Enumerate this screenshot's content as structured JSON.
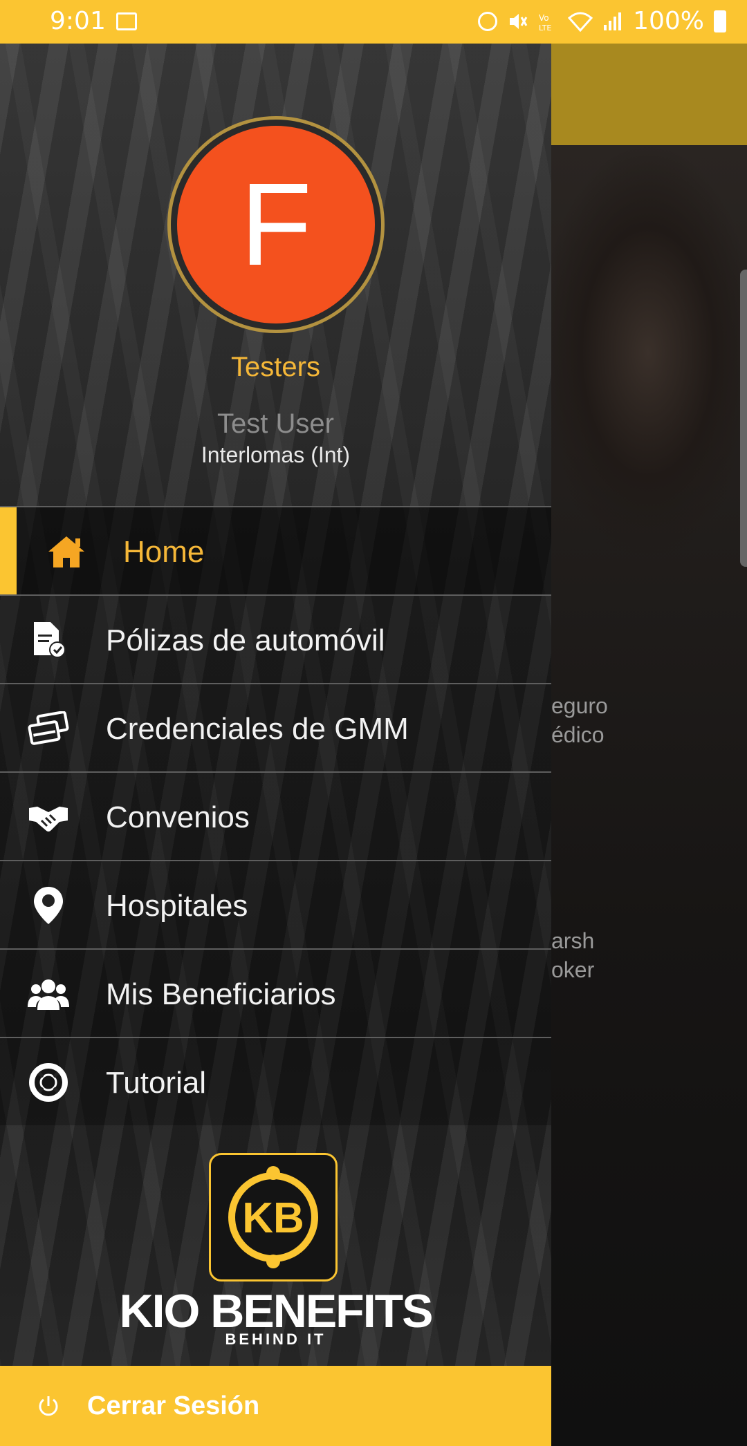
{
  "status_bar": {
    "time": "9:01",
    "battery": "100%"
  },
  "background": {
    "text_1": "eguro\nédico",
    "text_2": "arsh\noker"
  },
  "profile": {
    "initial": "F",
    "organization": "Testers",
    "user_name": "Test User",
    "branch": "Interlomas (Int)",
    "avatar_color": "#f4511e"
  },
  "menu": {
    "items": [
      {
        "label": "Home",
        "icon": "home-icon"
      },
      {
        "label": "Pólizas de automóvil",
        "icon": "policy-document-icon"
      },
      {
        "label": "Credenciales de GMM",
        "icon": "credit-cards-icon"
      },
      {
        "label": "Convenios",
        "icon": "handshake-icon"
      },
      {
        "label": "Hospitales",
        "icon": "map-pin-icon"
      },
      {
        "label": "Mis Beneficiarios",
        "icon": "users-icon"
      },
      {
        "label": "Tutorial",
        "icon": "lifebuoy-icon"
      }
    ]
  },
  "logo": {
    "mark": "KB",
    "name": "KIO BENEFITS",
    "tagline": "BEHIND IT"
  },
  "logout": {
    "label": "Cerrar Sesión"
  },
  "colors": {
    "accent": "#fbc531",
    "active_text": "#f5b738"
  }
}
